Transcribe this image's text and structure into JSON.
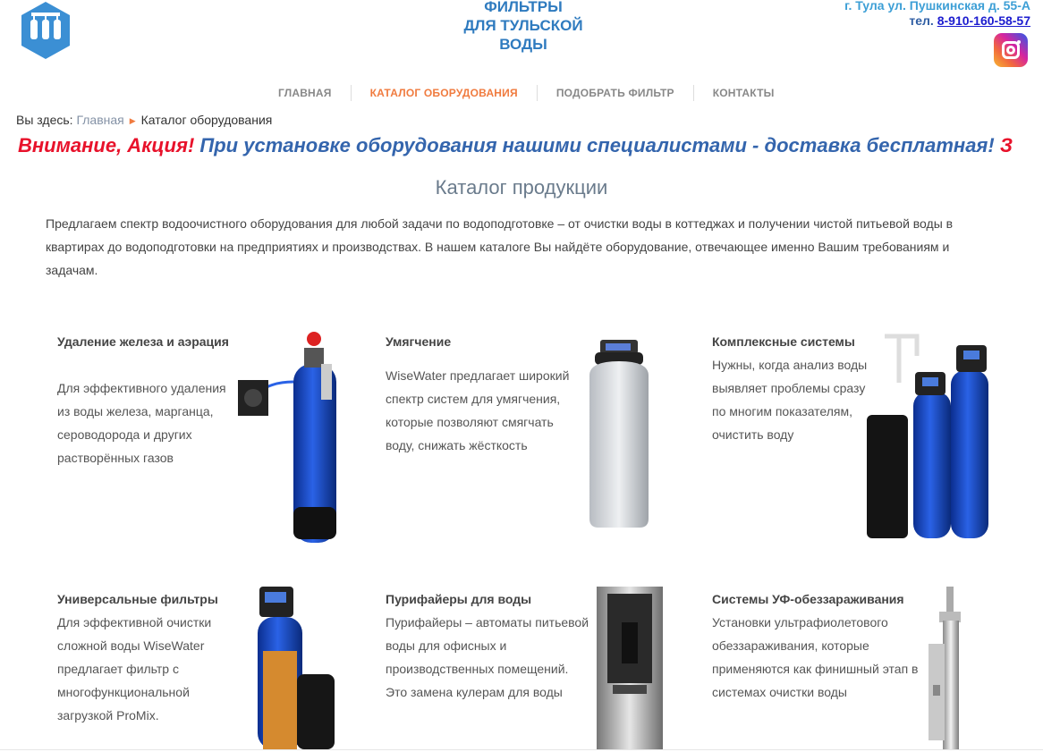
{
  "header": {
    "brand": "ФИЛЬТРЫ ДЛЯ ТУЛЬСКОЙ ВОДЫ",
    "brand_lines": [
      "ФИЛЬТРЫ",
      "ДЛЯ ТУЛЬСКОЙ",
      "ВОДЫ"
    ],
    "address": "г. Тула ул. Пушкинская д. 55-А",
    "phone_label": "тел.",
    "phone": "8-910-160-58-57",
    "icons": [
      "filters-logo-icon",
      "instagram-icon"
    ]
  },
  "nav": {
    "items": [
      {
        "label": "ГЛАВНАЯ",
        "active": false
      },
      {
        "label": "КАТАЛОГ ОБОРУДОВАНИЯ",
        "active": true
      },
      {
        "label": "ПОДОБРАТЬ ФИЛЬТР",
        "active": false
      },
      {
        "label": "КОНТАКТЫ",
        "active": false
      }
    ]
  },
  "breadcrumb": {
    "prefix": "Вы здесь:",
    "home": "Главная",
    "current": "Каталог оборудования"
  },
  "promo": {
    "alert": "Внимание, Акция!",
    "message": "При установке оборудования нашими специалистами - доставка бесплатная!",
    "tail": "З"
  },
  "catalog": {
    "title": "Каталог продукции",
    "intro": "Предлагаем спектр водоочистного оборудования для любой задачи по водоподготовке – от очистки воды в коттеджах и получении чистой питьевой воды в квартирах до водоподготовки на предприятиях и производствах. В нашем каталоге Вы найдёте оборудование, отвечающее именно Вашим требованиям и задачам.",
    "cards": [
      {
        "title": "Удаление железа и аэрация",
        "text": "Для эффективного удаления из воды железа, марганца, сероводорода и других растворённых газов"
      },
      {
        "title": "Умягчение",
        "text": "WiseWater предлагает широкий спектр систем для умягчения, которые позволяют смягчать воду, снижать жёсткость"
      },
      {
        "title": "Комплексные системы",
        "text": "Нужны, когда анализ воды выявляет проблемы сразу по многим показателям, очистить воду"
      },
      {
        "title": "Универсальные фильтры",
        "text": "Для эффективной очистки сложной воды WiseWater предлагает фильтр с многофункциональной загрузкой ProMix."
      },
      {
        "title": "Пурифайеры для воды",
        "text": "Пурифайеры – автоматы питьевой воды для офисных и производственных помещений. Это замена кулерам для воды"
      },
      {
        "title": "Системы УФ-обеззараживания",
        "text": "Установки ультрафиолетового обеззараживания, которые применяются как финишный этап в системах очистки воды"
      }
    ]
  },
  "colors": {
    "brand_blue": "#2f7bbf",
    "nav_active": "#f07b3f",
    "promo_red": "#e8122b",
    "promo_blue": "#3465ad"
  }
}
